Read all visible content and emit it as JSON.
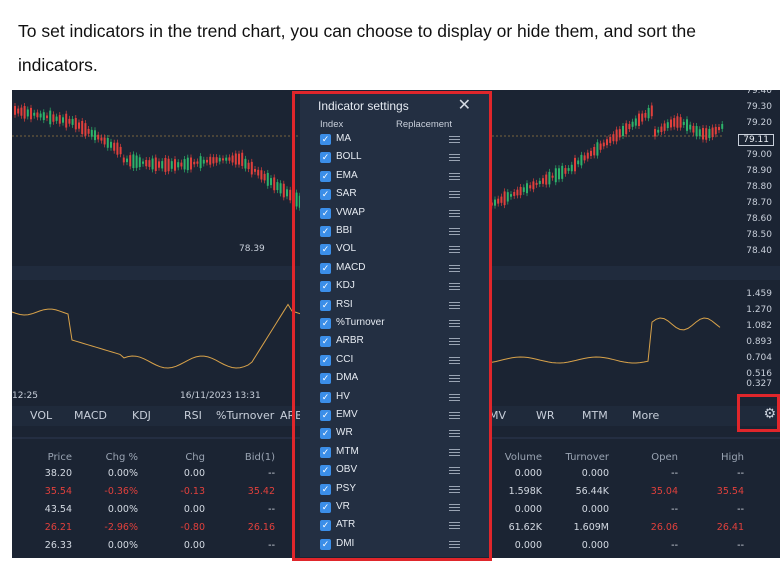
{
  "intro_text": "To set indicators in the trend chart, you can choose to display or hide them, and sort the indicators.",
  "chart": {
    "price_ticks": [
      "79.40",
      "79.30",
      "79.20",
      "79.11",
      "79.00",
      "78.90",
      "78.80",
      "78.70",
      "78.60",
      "78.50",
      "78.40"
    ],
    "current_price": "79.11",
    "low_label": "78.39",
    "sub_ticks": [
      "1.459",
      "1.270",
      "1.082",
      "0.893",
      "0.704",
      "0.516",
      "0.327"
    ],
    "time_left": "12:25",
    "time_center": "16/11/2023 13:31"
  },
  "tabs": [
    "VOL",
    "MACD",
    "KDJ",
    "RSI",
    "%Turnover",
    "ARBR",
    "EMV",
    "WR",
    "MTM",
    "More"
  ],
  "panel": {
    "title": "Indicator settings",
    "col_index": "Index",
    "col_replacement": "Replacement",
    "indicators": [
      "MA",
      "BOLL",
      "EMA",
      "SAR",
      "VWAP",
      "BBI",
      "VOL",
      "MACD",
      "KDJ",
      "RSI",
      "%Turnover",
      "ARBR",
      "CCI",
      "DMA",
      "HV",
      "EMV",
      "WR",
      "MTM",
      "OBV",
      "PSY",
      "VR",
      "ATR",
      "DMI"
    ]
  },
  "table_left": {
    "headers": [
      "Price",
      "Chg %",
      "Chg",
      "Bid(1)"
    ],
    "rows": [
      {
        "cells": [
          "38.20",
          "0.00%",
          "0.00",
          "--"
        ],
        "color": "neutral"
      },
      {
        "cells": [
          "35.54",
          "-0.36%",
          "-0.13",
          "35.42"
        ],
        "color": "down"
      },
      {
        "cells": [
          "43.54",
          "0.00%",
          "0.00",
          "--"
        ],
        "color": "neutral"
      },
      {
        "cells": [
          "26.21",
          "-2.96%",
          "-0.80",
          "26.16"
        ],
        "color": "down"
      },
      {
        "cells": [
          "26.33",
          "0.00%",
          "0.00",
          "--"
        ],
        "color": "neutral"
      }
    ]
  },
  "table_right": {
    "headers": [
      "Volume",
      "Turnover",
      "Open",
      "High"
    ],
    "rows": [
      {
        "cells": [
          "0.000",
          "0.000",
          "--",
          "--"
        ],
        "colors": [
          "n",
          "n",
          "n",
          "n"
        ]
      },
      {
        "cells": [
          "1.598K",
          "56.44K",
          "35.04",
          "35.54"
        ],
        "colors": [
          "n",
          "n",
          "r",
          "r"
        ]
      },
      {
        "cells": [
          "0.000",
          "0.000",
          "--",
          "--"
        ],
        "colors": [
          "n",
          "n",
          "n",
          "n"
        ]
      },
      {
        "cells": [
          "61.62K",
          "1.609M",
          "26.06",
          "26.41"
        ],
        "colors": [
          "n",
          "n",
          "r",
          "r"
        ]
      },
      {
        "cells": [
          "0.000",
          "0.000",
          "--",
          "--"
        ],
        "colors": [
          "n",
          "n",
          "n",
          "n"
        ]
      }
    ]
  },
  "colors": {
    "up": "#2db36a",
    "down": "#e0403c",
    "accent": "#3b8ee8",
    "highlight": "#e0262b",
    "line": "#d8a24a"
  }
}
